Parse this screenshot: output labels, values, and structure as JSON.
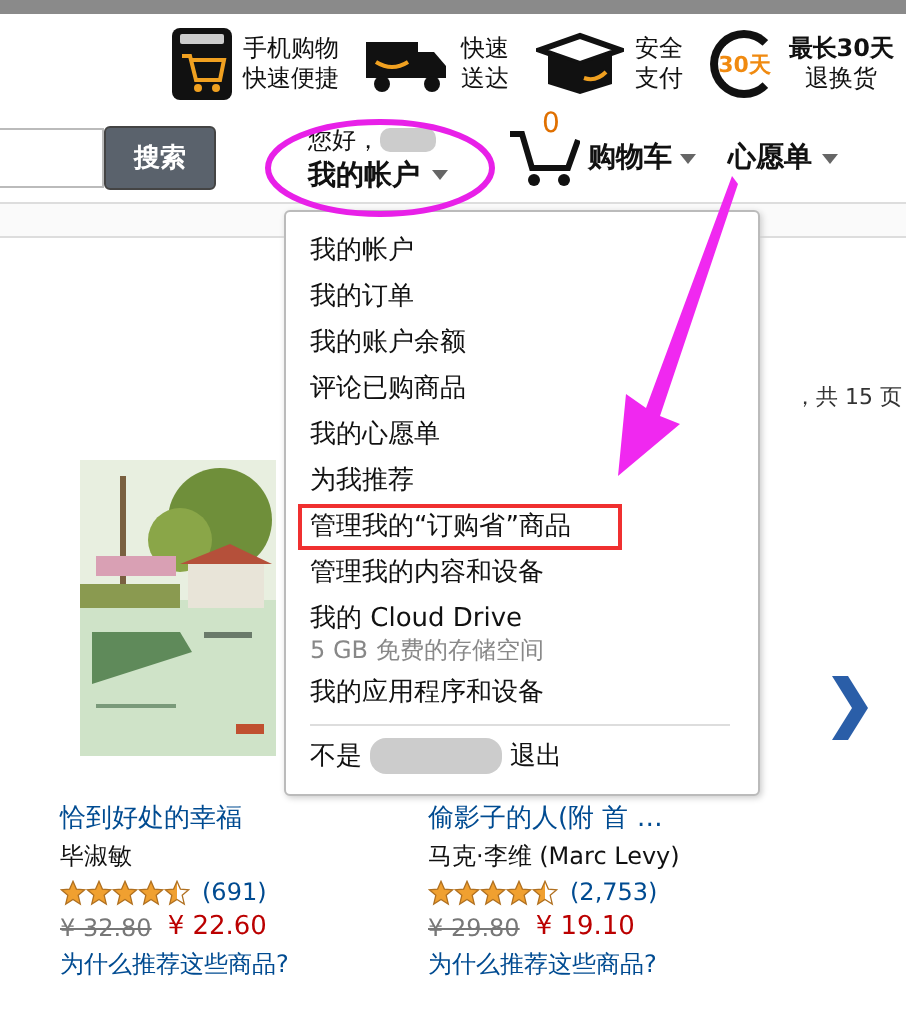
{
  "features": [
    {
      "kind": "app",
      "lines": [
        "手机购物",
        "快速便捷"
      ]
    },
    {
      "kind": "truck",
      "lines": [
        "快速",
        "送达"
      ]
    },
    {
      "kind": "box",
      "lines": [
        "安全",
        "支付"
      ]
    },
    {
      "kind": "return",
      "badge": "30天",
      "lines": [
        "最长30天",
        "退换货"
      ]
    }
  ],
  "search": {
    "button": "搜索"
  },
  "account": {
    "greeting": "您好，",
    "label": "我的帐户",
    "circled": true
  },
  "cart": {
    "count": "0",
    "label": "购物车"
  },
  "wishlist": {
    "label": "心愿单"
  },
  "page_info": "，共 15 页",
  "menu": {
    "items": [
      {
        "label": "我的帐户",
        "highlighted": false
      },
      {
        "label": "我的订单",
        "highlighted": false
      },
      {
        "label": "我的账户余额",
        "highlighted": false
      },
      {
        "label": "评论已购商品",
        "highlighted": false
      },
      {
        "label": "我的心愿单",
        "highlighted": false
      },
      {
        "label": "为我推荐",
        "highlighted": false
      },
      {
        "label": "管理我的“订购省”商品",
        "highlighted": true
      },
      {
        "label": "管理我的内容和设备",
        "highlighted": false
      },
      {
        "label": "我的 Cloud Drive",
        "sub": "5 GB 免费的存储空间",
        "highlighted": false
      },
      {
        "label": "我的应用程序和设备",
        "highlighted": false
      }
    ],
    "signout": {
      "prefix": "不是",
      "action": "退出"
    }
  },
  "products": [
    {
      "title": "恰到好处的幸福",
      "author": "毕淑敏",
      "stars": 4.5,
      "reviews": "(691)",
      "list_price": "¥ 32.80",
      "price": "¥ 22.60",
      "why": "为什么推荐这些商品?",
      "kind": "picture"
    },
    {
      "title": "偷影子的人(附 首 …",
      "author": "马克·李维 (Marc Levy)",
      "stars": 4.5,
      "reviews": "(2,753)",
      "list_price": "¥ 29.80",
      "price": "¥ 19.10",
      "why": "为什么推荐这些商品?"
    }
  ]
}
